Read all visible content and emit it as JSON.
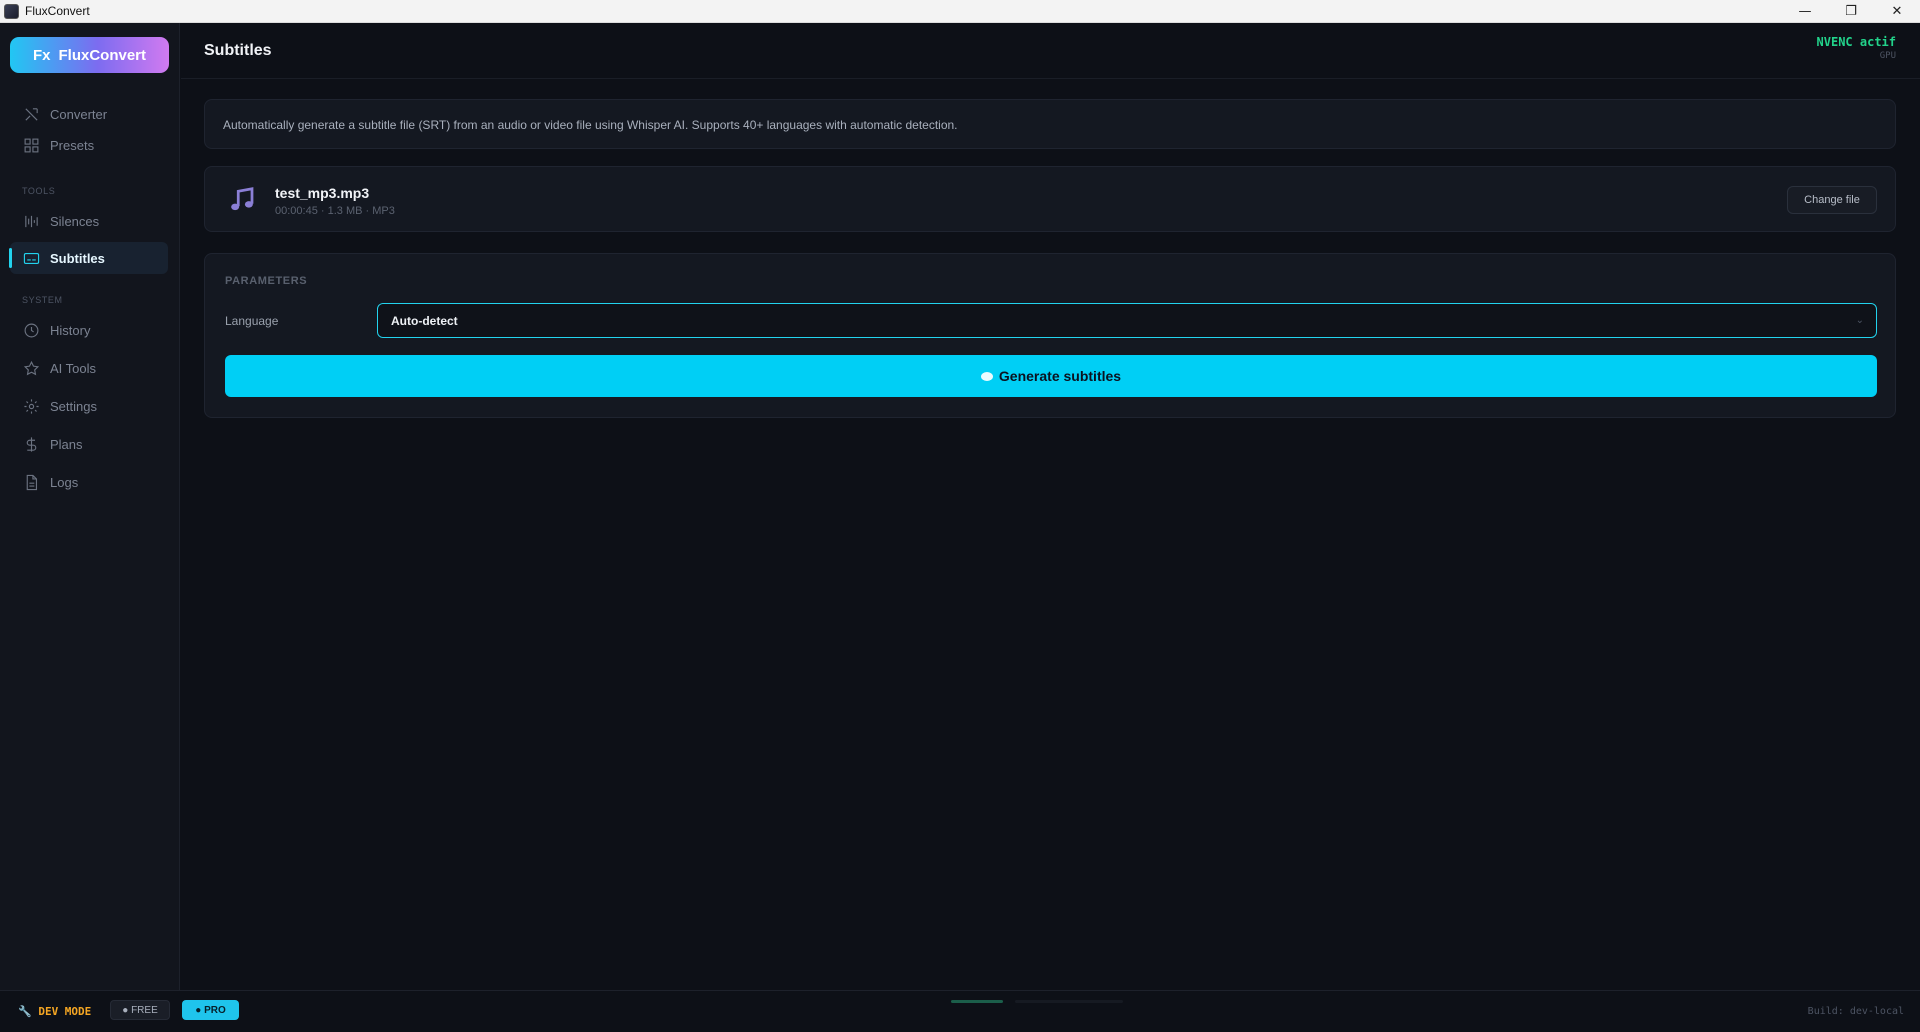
{
  "window": {
    "title": "FluxConvert",
    "controls": {
      "minimize": "—",
      "restore": "❐",
      "close": "✕"
    }
  },
  "sidebar": {
    "brand": {
      "prefix": "Fx",
      "name": "FluxConvert"
    },
    "items_top": [
      {
        "label": "Converter",
        "icon": "converter-icon"
      },
      {
        "label": "Presets",
        "icon": "grid-icon"
      }
    ],
    "tools_label": "TOOLS",
    "tools": [
      {
        "label": "Silences",
        "icon": "waveform-icon"
      },
      {
        "label": "Subtitles",
        "icon": "subtitles-icon",
        "active": true
      }
    ],
    "system_label": "SYSTEM",
    "system": [
      {
        "label": "History",
        "icon": "clock-icon"
      },
      {
        "label": "AI Tools",
        "icon": "star-icon"
      },
      {
        "label": "Settings",
        "icon": "gear-icon"
      },
      {
        "label": "Plans",
        "icon": "dollar-icon"
      },
      {
        "label": "Logs",
        "icon": "document-icon"
      }
    ]
  },
  "header": {
    "title": "Subtitles",
    "gpu_status": "NVENC actif",
    "gpu_label": "GPU"
  },
  "info": {
    "text": "Automatically generate a subtitle file (SRT) from an audio or video file using Whisper AI. Supports 40+ languages with automatic detection."
  },
  "file": {
    "name": "test_mp3.mp3",
    "meta": "00:00:45 · 1.3 MB · MP3",
    "change_label": "Change file"
  },
  "params": {
    "title": "PARAMETERS",
    "language_label": "Language",
    "language_value": "Auto-detect",
    "generate_label": "Generate subtitles"
  },
  "footer": {
    "dev_mode": "🔧 DEV MODE",
    "free": "● FREE",
    "pro": "● PRO",
    "build": "Build: dev-local"
  },
  "colors": {
    "accent": "#22d3ee",
    "button": "#00cff5",
    "nvenc": "#22d38b",
    "dev_mode": "#f5a623"
  }
}
